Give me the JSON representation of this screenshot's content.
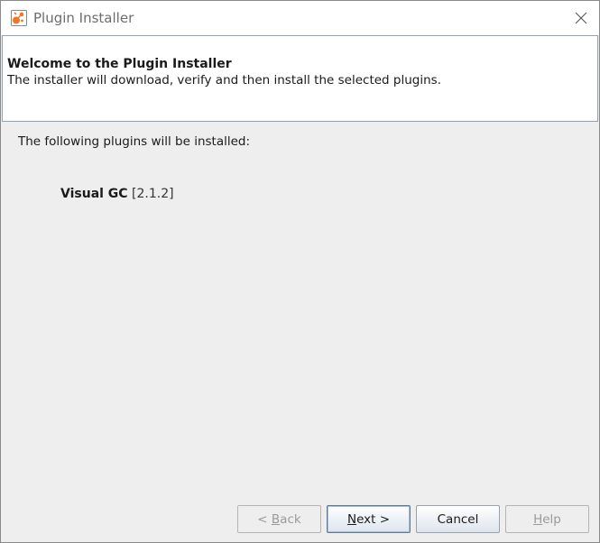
{
  "window": {
    "title": "Plugin Installer",
    "app_icon": "plugin-installer-app-icon",
    "close_icon": "close-icon"
  },
  "header": {
    "title": "Welcome to the Plugin Installer",
    "description": "The installer will download, verify and then install the selected plugins."
  },
  "content": {
    "label": "The following plugins will be installed:",
    "plugins": [
      {
        "name": "Visual GC",
        "version": "[2.1.2]"
      }
    ]
  },
  "buttons": {
    "back": {
      "pre": "< ",
      "mnemonic": "B",
      "rest": "ack",
      "enabled": false
    },
    "next": {
      "pre": "",
      "mnemonic": "N",
      "rest": "ext >",
      "enabled": true
    },
    "cancel": {
      "label": "Cancel",
      "enabled": true
    },
    "help": {
      "pre": "",
      "mnemonic": "H",
      "rest": "elp",
      "enabled": false
    }
  },
  "colors": {
    "accent_icon": "#f07828",
    "panel_border": "#8fa4b8"
  }
}
